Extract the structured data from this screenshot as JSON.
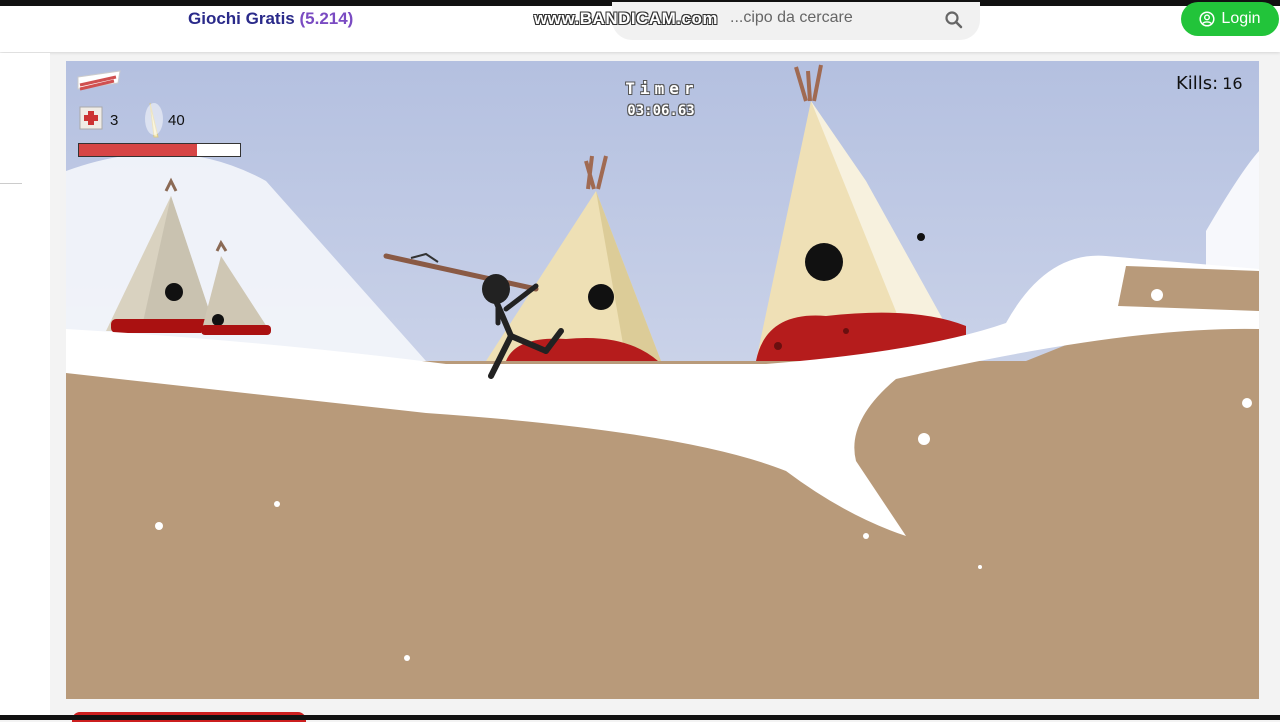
{
  "header": {
    "site_title": "Giochi Gratis",
    "site_count": "(5.214)",
    "search_placeholder": "...cipo da cercare",
    "login_label": "Login",
    "watermark": "www.BANDICAM.com"
  },
  "hud": {
    "medkits": "3",
    "ammo": "40",
    "timer_label": "Timer",
    "timer_value": "03:06.63",
    "kills_label": "Kills:",
    "kills_value": "16",
    "health_fraction": 0.73
  },
  "colors": {
    "sky_top": "#b7c3e2",
    "sky_bottom": "#dfe4f1",
    "ground": "#b89a7a",
    "snow": "#ffffff",
    "teepee": "#efe0b4",
    "teepee_trim": "#b81c1c",
    "login_green": "#22c43a",
    "title_blue": "#2a2a8a",
    "count_purple": "#7a4bc2"
  },
  "icons": {
    "search": "search-icon",
    "user": "user-circle-icon",
    "medkit": "medkit-icon",
    "ammo": "spear-ammo-icon",
    "weapon": "weapon-icon"
  }
}
